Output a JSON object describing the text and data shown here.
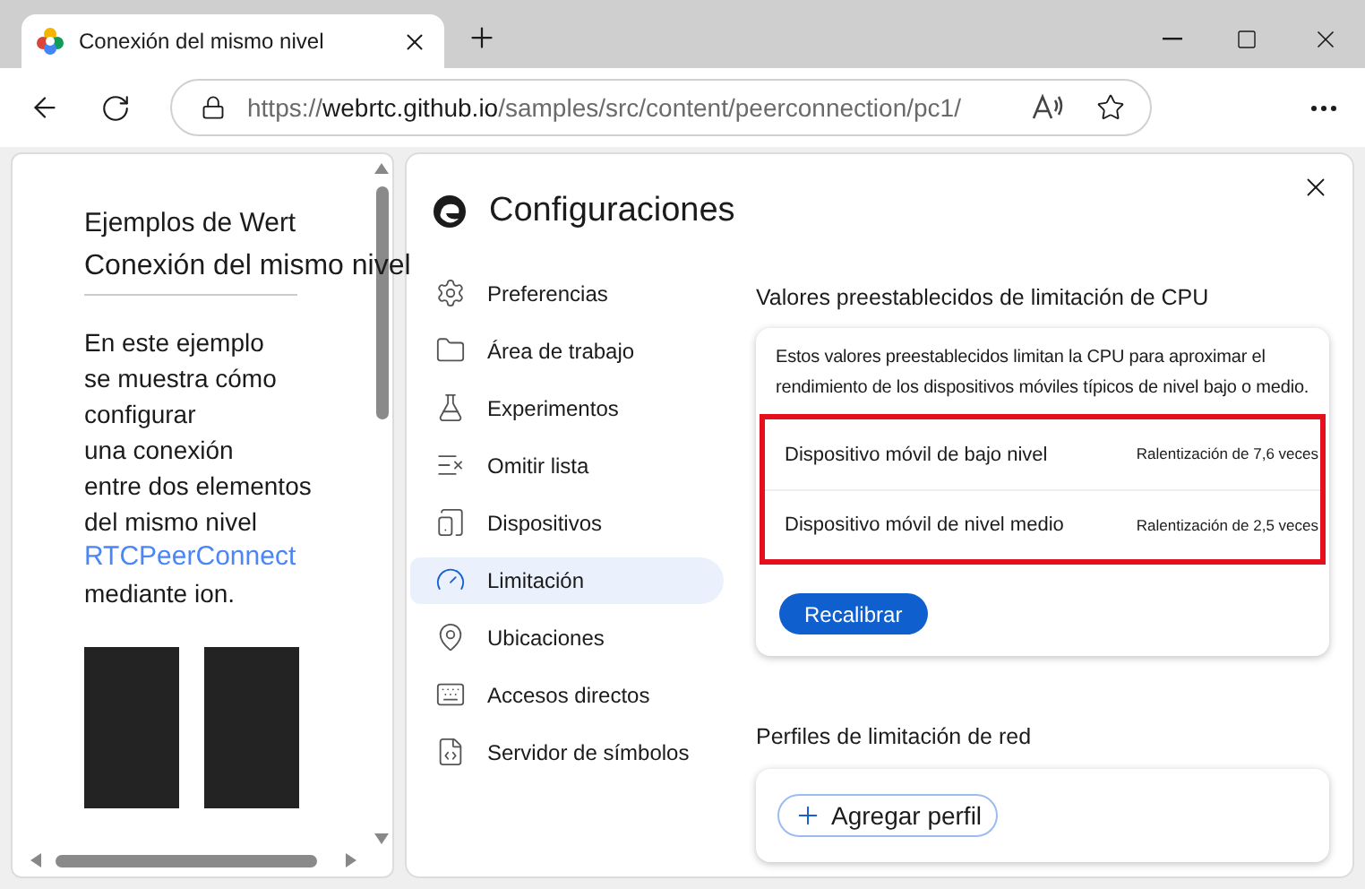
{
  "tab": {
    "title": "Conexión del mismo nivel",
    "selected": true
  },
  "address": {
    "scheme": "https://",
    "host": "webrtc.github.io",
    "path": "/samples/src/content/peerconnection/pc1/"
  },
  "page": {
    "site_title": "Ejemplos de Wert",
    "heading": "Conexión del mismo nivel",
    "lines": [
      {
        "kind": "text",
        "text": "En este ejemplo"
      },
      {
        "kind": "text",
        "text": "se muestra cómo"
      },
      {
        "kind": "text",
        "text": "configurar"
      },
      {
        "kind": "text",
        "text": "una conexión"
      },
      {
        "kind": "text",
        "text": "entre dos elementos"
      },
      {
        "kind": "text",
        "text": "del mismo nivel"
      },
      {
        "kind": "link",
        "text": "RTCPeerConnect"
      },
      {
        "kind": "text",
        "text": "mediante ion."
      }
    ]
  },
  "settings": {
    "title": "Configuraciones",
    "sidebar": {
      "items": [
        {
          "label": "Preferencias",
          "selected": false
        },
        {
          "label": "Área de trabajo",
          "selected": false
        },
        {
          "label": "Experimentos",
          "selected": false
        },
        {
          "label": "Omitir lista",
          "selected": false
        },
        {
          "label": "Dispositivos",
          "selected": false
        },
        {
          "label": "Limitación",
          "selected": true
        },
        {
          "label": "Ubicaciones",
          "selected": false
        },
        {
          "label": "Accesos directos",
          "selected": false
        },
        {
          "label": "Servidor de símbolos",
          "selected": false
        }
      ]
    },
    "cpu": {
      "heading": "Valores preestablecidos de limitación de CPU",
      "description": "Estos valores preestablecidos limitan la CPU para aproximar el rendimiento de los dispositivos móviles típicos de nivel bajo o medio.",
      "highlighted": true,
      "presets": [
        {
          "name": "Dispositivo móvil de bajo nivel",
          "value": "Ralentización de 7,6 veces"
        },
        {
          "name": "Dispositivo móvil de nivel medio",
          "value": "Ralentización de 2,5 veces"
        }
      ],
      "button": "Recalibrar"
    },
    "network": {
      "heading": "Perfiles de limitación de red",
      "button": "Agregar perfil"
    }
  }
}
